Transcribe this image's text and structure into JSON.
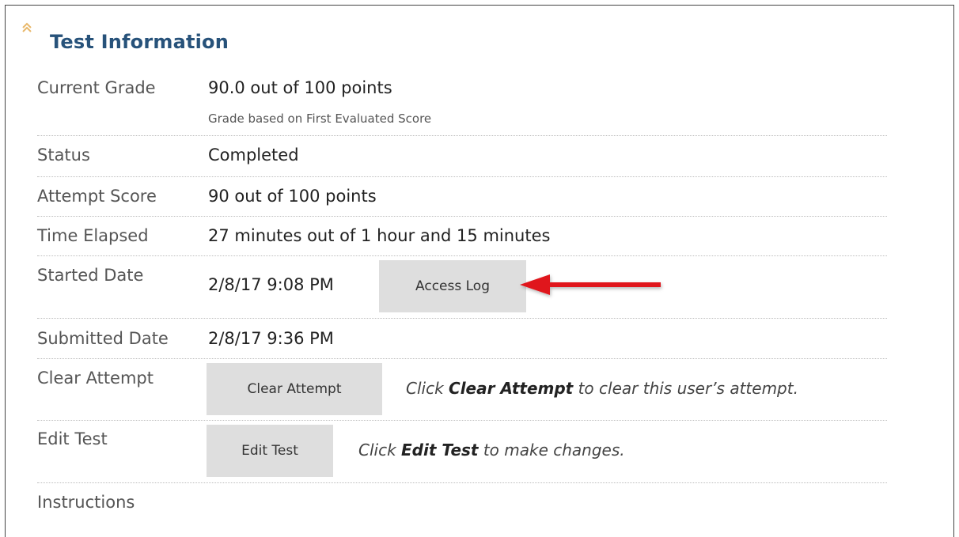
{
  "section": {
    "title": "Test Information"
  },
  "rows": {
    "current_grade": {
      "label": "Current Grade",
      "value": "90.0 out of 100 points",
      "note": "Grade based on First Evaluated Score"
    },
    "status": {
      "label": "Status",
      "value": "Completed"
    },
    "attempt_score": {
      "label": "Attempt Score",
      "value": "90 out of 100 points"
    },
    "time_elapsed": {
      "label": "Time Elapsed",
      "value": "27 minutes out of 1 hour and 15 minutes"
    },
    "started_date": {
      "label": "Started Date",
      "value": "2/8/17 9:08 PM",
      "button": "Access Log"
    },
    "submitted_date": {
      "label": "Submitted Date",
      "value": "2/8/17 9:36 PM"
    },
    "clear_attempt": {
      "label": "Clear Attempt",
      "button": "Clear Attempt",
      "hint_pre": "Click ",
      "hint_bold": "Clear Attempt",
      "hint_post": " to clear this user’s attempt."
    },
    "edit_test": {
      "label": "Edit Test",
      "button": "Edit Test",
      "hint_pre": "Click ",
      "hint_bold": "Edit Test",
      "hint_post": " to make changes."
    },
    "instructions": {
      "label": "Instructions"
    }
  },
  "icons": {
    "collapse": "double-chevron-up-icon",
    "annotation": "red-arrow-icon"
  },
  "colors": {
    "title": "#27527a",
    "button_bg": "#dedede",
    "annotation_arrow": "#e0191d",
    "collapse_icon": "#e8b86b"
  }
}
